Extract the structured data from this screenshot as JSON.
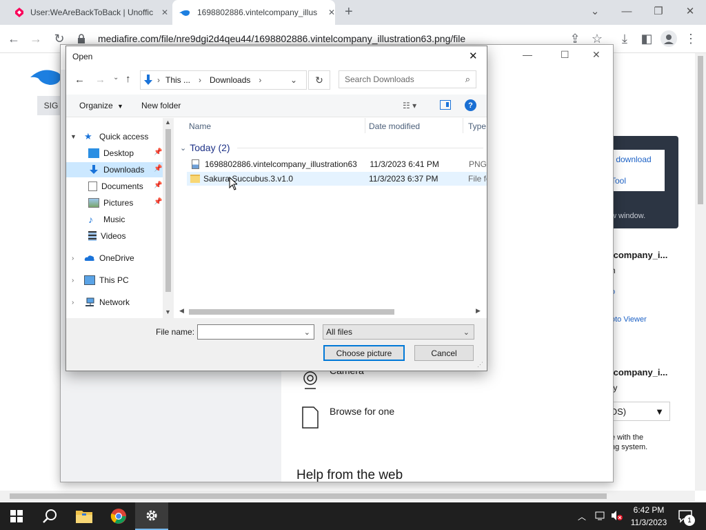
{
  "browser": {
    "tabs": [
      {
        "title": "User:WeAreBackToBack | Unoffic",
        "active": false
      },
      {
        "title": "1698802886.vintelcompany_illus",
        "active": true
      }
    ],
    "new_tab": "+",
    "address": "mediafire.com/file/nre9dgi2d4qeu44/1698802886.vintelcompany_illustration63.png/file",
    "window_controls": {
      "chevron": "⌄",
      "minimize": "—",
      "restore": "❐",
      "close": "✕"
    }
  },
  "page_bg": {
    "signin_fragment": "SIG",
    "download_link": "r download",
    "tool_link": "Tool",
    "new_window_hint": "w window.",
    "card1_title": "lcompany_i...",
    "card1_line1": "h",
    "card1_link1": "o",
    "card1_link2": "oto Viewer",
    "card2_title": "lcompany_i...",
    "card2_line1": "ty",
    "card2_select": "OS)",
    "card2_note1": "e with the",
    "card2_note2": "ng system."
  },
  "settings": {
    "camera_label": "Camera",
    "browse_label": "Browse for one",
    "help_heading": "Help from the web",
    "controls": {
      "minimize": "—",
      "maximize": "☐",
      "close": "✕"
    }
  },
  "dialog": {
    "title": "Open",
    "close": "✕",
    "breadcrumb": [
      "This ...",
      "Downloads"
    ],
    "search_placeholder": "Search Downloads",
    "organize": "Organize",
    "new_folder": "New folder",
    "nav": [
      {
        "label": "Quick access",
        "icon": "star-icon",
        "pinned": false
      },
      {
        "label": "Desktop",
        "icon": "desktop-icon",
        "pinned": true
      },
      {
        "label": "Downloads",
        "icon": "download-arrow-icon",
        "pinned": true,
        "selected": true
      },
      {
        "label": "Documents",
        "icon": "documents-icon",
        "pinned": true
      },
      {
        "label": "Pictures",
        "icon": "pictures-icon",
        "pinned": true
      },
      {
        "label": "Music",
        "icon": "music-note-icon",
        "pinned": false
      },
      {
        "label": "Videos",
        "icon": "film-icon",
        "pinned": false
      },
      {
        "label": "OneDrive",
        "icon": "cloud-icon",
        "pinned": false
      },
      {
        "label": "This PC",
        "icon": "computer-icon",
        "pinned": false
      },
      {
        "label": "Network",
        "icon": "network-icon",
        "pinned": false
      }
    ],
    "columns": {
      "name": "Name",
      "date": "Date modified",
      "type": "Type"
    },
    "group": "Today (2)",
    "files": [
      {
        "name": "1698802886.vintelcompany_illustration63",
        "date": "11/3/2023 6:41 PM",
        "type": "PNG"
      },
      {
        "name": "Sakura.Succubus.3.v1.0",
        "date": "11/3/2023 6:37 PM",
        "type": "File fo"
      }
    ],
    "filename_label": "File name:",
    "filename_value": "",
    "filter": "All files",
    "choose_btn": "Choose picture",
    "cancel_btn": "Cancel"
  },
  "taskbar": {
    "time": "6:42 PM",
    "date": "11/3/2023",
    "notification_count": "1"
  },
  "colors": {
    "accent": "#0078d7",
    "taskbar": "#1f1f1f",
    "selection": "#cce8ff"
  }
}
